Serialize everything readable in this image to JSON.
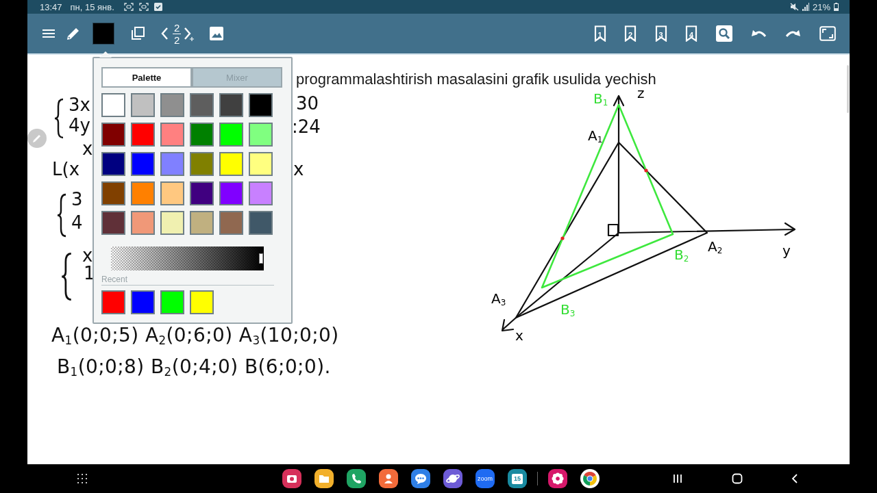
{
  "status_bar": {
    "time": "13:47",
    "date": "пн, 15 янв.",
    "battery": "21%"
  },
  "toolbar": {
    "pen": {
      "color": "#000000"
    },
    "page": {
      "current": "2",
      "total": "2"
    },
    "bookmarks": [
      "1",
      "2",
      "3",
      "4"
    ]
  },
  "color_picker": {
    "tabs": [
      {
        "label": "Palette",
        "selected": true
      },
      {
        "label": "Mixer",
        "selected": false
      }
    ],
    "swatches": [
      {
        "color": "#ffffff"
      },
      {
        "color": "#c0c0c0"
      },
      {
        "color": "#8f8f8f"
      },
      {
        "color": "#5e5e5e"
      },
      {
        "color": "#404040"
      },
      {
        "color": "#000000"
      },
      {
        "color": "#800000"
      },
      {
        "color": "#ff0000"
      },
      {
        "color": "#ff8080"
      },
      {
        "color": "#008000"
      },
      {
        "color": "#00ff00"
      },
      {
        "color": "#80ff80"
      },
      {
        "color": "#000080"
      },
      {
        "color": "#0000ff"
      },
      {
        "color": "#8080ff"
      },
      {
        "color": "#808000"
      },
      {
        "color": "#ffff00"
      },
      {
        "color": "#ffff80"
      },
      {
        "color": "#804000"
      },
      {
        "color": "#ff8000"
      },
      {
        "color": "#ffc880"
      },
      {
        "color": "#400080"
      },
      {
        "color": "#8000ff"
      },
      {
        "color": "#c880ff"
      },
      {
        "color": "#603038"
      },
      {
        "color": "#f09878"
      },
      {
        "color": "#f0f0b0"
      },
      {
        "color": "#c0b080"
      },
      {
        "color": "#906850"
      },
      {
        "color": "#405868"
      }
    ],
    "opacity": {
      "level": 0.98
    },
    "recent_label": "Recent",
    "recent": [
      {
        "color": "#ff0000"
      },
      {
        "color": "#0000ff"
      },
      {
        "color": "#00ff00"
      },
      {
        "color": "#ffff00"
      }
    ]
  },
  "document": {
    "title": "programmalashtirish masalasini grafik usulida yechish",
    "handwriting": [
      "3x",
      "4y",
      "x",
      "L(x",
      "3",
      "4",
      "x",
      "1",
      "30",
      ":24",
      "x"
    ],
    "coordinates": [
      "A$_{1}$(0;0;5) A$_{2}$(0;6;0) A$_{3}$(10;0;0)",
      "B$_{1}$(0;0;8) B$_{2}$(0;4;0) B(6;0;0)."
    ],
    "diagram_labels": [
      {
        "text": "B$_{1}$",
        "color": "#33dd33"
      },
      {
        "text": "z",
        "color": "#000000"
      },
      {
        "text": "A$_{1}$",
        "color": "#000000"
      },
      {
        "text": "A$_{2}$",
        "color": "#000000"
      },
      {
        "text": "B$_{2}$",
        "color": "#33dd33"
      },
      {
        "text": "y",
        "color": "#000000"
      },
      {
        "text": "A$_{3}$",
        "color": "#000000"
      },
      {
        "text": "B$_{3}$",
        "color": "#33dd33"
      },
      {
        "text": "x",
        "color": "#000000"
      }
    ]
  },
  "dock": {
    "apps": [
      {
        "kind": "camera"
      },
      {
        "kind": "folder"
      },
      {
        "kind": "phone"
      },
      {
        "kind": "contacts"
      },
      {
        "kind": "messages"
      },
      {
        "kind": "planet"
      },
      {
        "kind": "zoom",
        "label": "zoom"
      },
      {
        "kind": "calendar",
        "label": "15"
      },
      {
        "kind": "flower"
      },
      {
        "kind": "tricolor"
      }
    ]
  }
}
